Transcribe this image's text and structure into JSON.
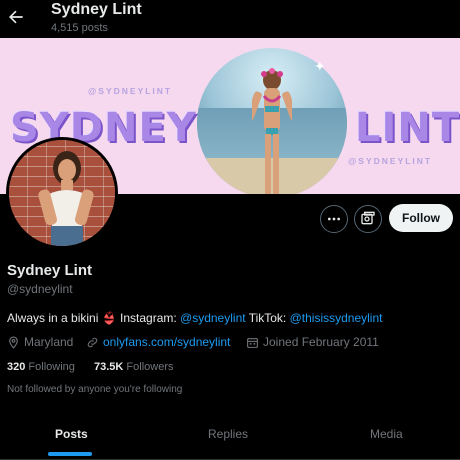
{
  "header": {
    "name": "Sydney Lint",
    "post_count": "4,515 posts"
  },
  "banner": {
    "handle_left": "@SYDNEYLINT",
    "handle_right": "@SYDNEYLINT",
    "name_left": "SYDNEY",
    "name_right": "LINT"
  },
  "actions": {
    "follow_label": "Follow"
  },
  "profile": {
    "name": "Sydney Lint",
    "handle": "@sydneylint",
    "bio_prefix": "Always in a bikini ",
    "bio_emoji": "👙",
    "bio_instagram_label": " Instagram: ",
    "bio_instagram": "@sydneylint",
    "bio_tiktok_label": " TikTok: ",
    "bio_tiktok": "@thisissydneylint",
    "location": "Maryland",
    "website": "onlyfans.com/sydneylint",
    "joined": "Joined February 2011",
    "following_count": "320",
    "following_label": "Following",
    "followers_count": "73.5K",
    "followers_label": "Followers",
    "not_followed": "Not followed by anyone you're following"
  },
  "tabs": [
    {
      "label": "Posts",
      "active": true
    },
    {
      "label": "Replies",
      "active": false
    },
    {
      "label": "Media",
      "active": false
    }
  ],
  "colors": {
    "accent": "#1d9bf0",
    "banner_bg": "#f6d9ef",
    "banner_text": "#a987e6"
  }
}
